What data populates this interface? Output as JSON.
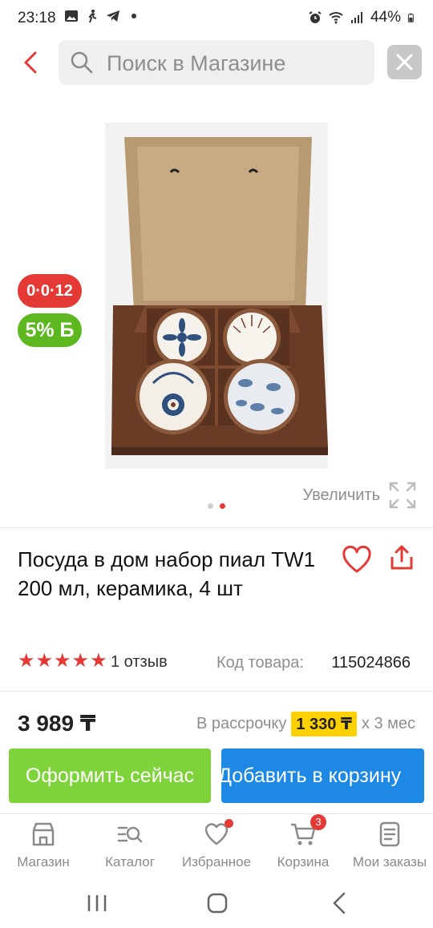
{
  "status_bar": {
    "time": "23:18",
    "battery": "44%",
    "icons": [
      "gallery-icon",
      "walk-icon",
      "telegram-icon",
      "dot-icon",
      "alarm-icon",
      "wifi-icon",
      "signal-icon",
      "battery-icon"
    ]
  },
  "search": {
    "placeholder": "Поиск в Магазине"
  },
  "gallery": {
    "badge_timer": "0·0·12",
    "badge_bonus": "5% Б",
    "zoom_label": "Увеличить",
    "page_count": 2,
    "active_page": 2
  },
  "product": {
    "title": "Посуда в дом набор пиал TW1 200 мл, керамика, 4 шт",
    "rating": 5,
    "reviews": "1 отзыв",
    "sku_label": "Код товара:",
    "sku_value": "115024866",
    "price": "3 989 ₸",
    "installment_label": "В рассрочку",
    "installment_amount": "1 330 ₸",
    "installment_term": "х 3 мес"
  },
  "actions": {
    "buy_now": "Оформить сейчас",
    "add_to_cart": "Добавить в корзину"
  },
  "bottom_nav": {
    "items": [
      {
        "label": "Магазин",
        "icon": "shop-icon"
      },
      {
        "label": "Каталог",
        "icon": "catalog-search-icon"
      },
      {
        "label": "Избранное",
        "icon": "heart-icon",
        "dot": true
      },
      {
        "label": "Корзина",
        "icon": "cart-icon",
        "count": "3"
      },
      {
        "label": "Мои заказы",
        "icon": "orders-icon"
      }
    ]
  },
  "colors": {
    "accent_red": "#e53935",
    "buy_green": "#7fd33a",
    "cart_blue": "#1e88e5",
    "bonus_green": "#5cb81e",
    "installment_yellow": "#ffd100"
  }
}
